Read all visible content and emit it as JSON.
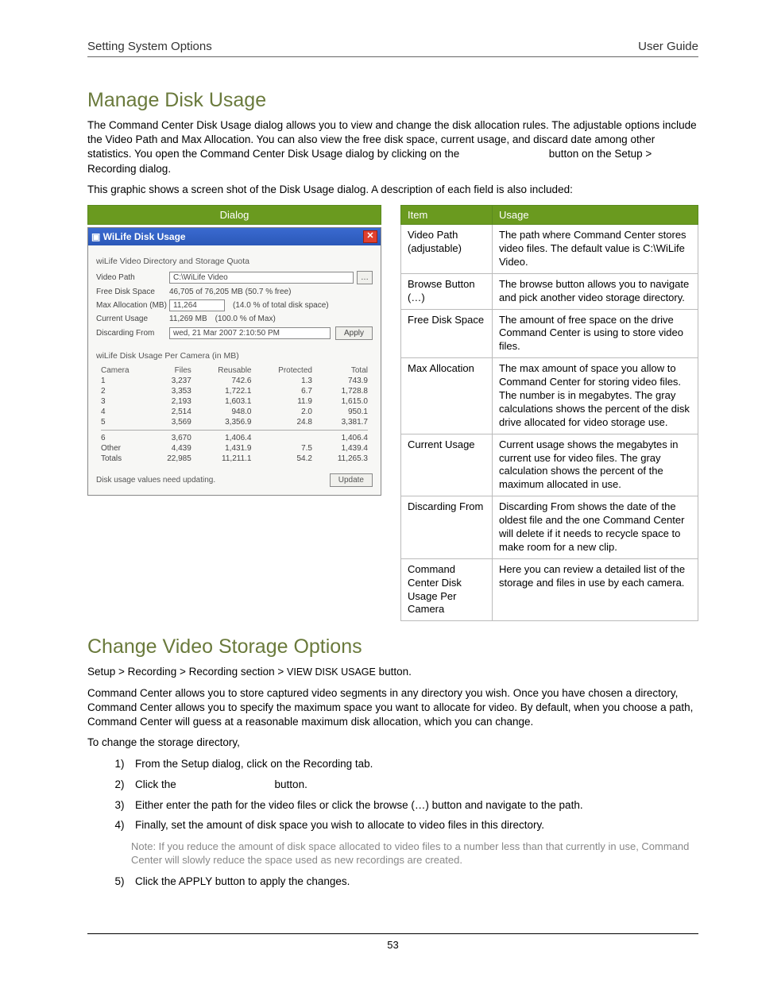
{
  "header": {
    "left": "Setting System Options",
    "right": "User Guide"
  },
  "sect1": {
    "title": "Manage Disk Usage",
    "p1": "The Command Center Disk Usage dialog allows you to view and change the disk allocation rules. The adjustable options include the Video Path and Max Allocation. You can also view the free disk space, current usage, and discard date among other statistics. You open the Command Center Disk Usage dialog by clicking on the                              button on the Setup > Recording dialog.",
    "p2": "This graphic shows a screen shot of the Disk Usage dialog. A description of each field is also included:"
  },
  "dialog_header": "Dialog",
  "dlg": {
    "title": "WiLife Disk Usage",
    "group1": "wiLife Video Directory and Storage Quota",
    "fields": {
      "video_path_label": "Video Path",
      "video_path_value": "C:\\WiLife Video",
      "free_label": "Free Disk Space",
      "free_value": "46,705 of 76,205 MB (50.7 % free)",
      "max_label": "Max Allocation (MB)",
      "max_value": "11,264",
      "max_pct": "(14.0 % of total disk space)",
      "cur_label": "Current Usage",
      "cur_value": "11,269 MB",
      "cur_pct": "(100.0 % of Max)",
      "disc_label": "Discarding From",
      "disc_value": "wed, 21 Mar 2007  2:10:50 PM",
      "apply": "Apply"
    },
    "group2": "wiLife Disk Usage Per Camera (in MB)",
    "cols": {
      "c1": "Camera",
      "c2": "Files",
      "c3": "Reusable",
      "c4": "Protected",
      "c5": "Total"
    },
    "rows": [
      {
        "c1": "1",
        "c2": "3,237",
        "c3": "742.6",
        "c4": "1.3",
        "c5": "743.9"
      },
      {
        "c1": "2",
        "c2": "3,353",
        "c3": "1,722.1",
        "c4": "6.7",
        "c5": "1,728.8"
      },
      {
        "c1": "3",
        "c2": "2,193",
        "c3": "1,603.1",
        "c4": "11.9",
        "c5": "1,615.0"
      },
      {
        "c1": "4",
        "c2": "2,514",
        "c3": "948.0",
        "c4": "2.0",
        "c5": "950.1"
      },
      {
        "c1": "5",
        "c2": "3,569",
        "c3": "3,356.9",
        "c4": "24.8",
        "c5": "3,381.7"
      },
      {
        "c1": "6",
        "c2": "3,670",
        "c3": "1,406.4",
        "c4": "",
        "c5": "1,406.4"
      },
      {
        "c1": "Other",
        "c2": "4,439",
        "c3": "1,431.9",
        "c4": "7.5",
        "c5": "1,439.4"
      },
      {
        "c1": "Totals",
        "c2": "22,985",
        "c3": "11,211.1",
        "c4": "54.2",
        "c5": "11,265.3"
      }
    ],
    "bottom_msg": "Disk usage values need updating.",
    "update": "Update"
  },
  "desc": {
    "th_item": "Item",
    "th_usage": "Usage",
    "rows": [
      {
        "item": "Video Path (adjustable)",
        "usage": "The path where Command Center stores video files. The default value is C:\\WiLife Video."
      },
      {
        "item": "Browse Button (…)",
        "usage": "The browse button allows you to navigate and pick another video storage directory."
      },
      {
        "item": "Free Disk Space",
        "usage": "The amount of free space on the drive Command Center is using to store video files."
      },
      {
        "item": "Max Allocation",
        "usage": "The max amount of space you allow to Command Center for storing video files. The number is in megabytes. The gray calculations shows the percent of the disk drive allocated for video storage use."
      },
      {
        "item": "Current Usage",
        "usage": "Current usage shows the megabytes in current use for video files. The gray calculation shows the percent of the maximum allocated in use."
      },
      {
        "item": "Discarding From",
        "usage": "Discarding From shows the date of the oldest file and the one Command Center will delete if it needs to recycle space to make room for a new clip."
      },
      {
        "item": "Command Center Disk Usage Per Camera",
        "usage": "Here you can review a detailed list of the storage and files in use by each camera."
      }
    ]
  },
  "sect2": {
    "title": "Change Video Storage Options",
    "path_a": "Setup > Recording > Recording section > ",
    "path_b": "VIEW DISK USAGE",
    "path_c": " button.",
    "p1": "Command Center allows you to store captured video segments in any directory you wish. Once you have chosen a directory, Command Center allows you to specify the maximum space you want to allocate for video. By default, when you choose a path, Command Center will guess at a reasonable maximum disk allocation, which you can change.",
    "p2": "To change the storage directory,",
    "steps": [
      "From the Setup dialog, click on the Recording tab.",
      "Click the                                 button.",
      "Either enter the path for the video files or click the browse (…) button and navigate to the path.",
      "Finally, set the amount of disk space you wish to allocate to video files in this directory.",
      "Click the APPLY button to apply the changes."
    ],
    "note": "Note: If you reduce the amount of disk space allocated to video files to a number less than that currently in use, Command Center will slowly reduce the space used as new recordings are created."
  },
  "page_number": "53"
}
